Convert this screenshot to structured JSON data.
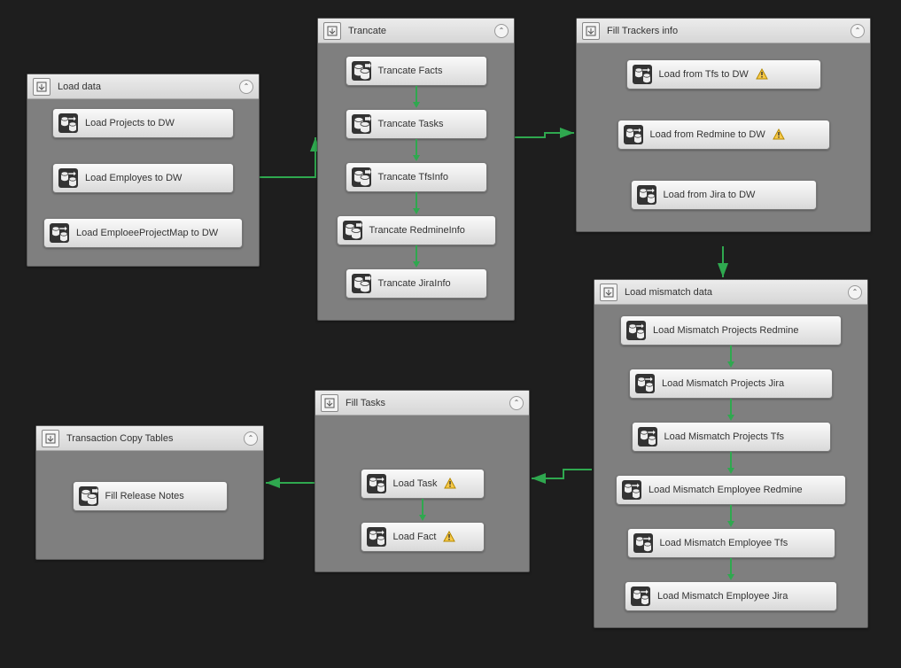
{
  "colors": {
    "connector": "#2fa84f",
    "canvas": "#1e1e1e",
    "container": "#7f7f7f"
  },
  "containers": {
    "loadData": {
      "title": "Load data",
      "tasks": [
        {
          "label": "Load Projects to DW",
          "icon": "dataflow",
          "warn": false
        },
        {
          "label": "Load Employes to DW",
          "icon": "dataflow",
          "warn": false
        },
        {
          "label": "Load EmploeeProjectMap to DW",
          "icon": "dataflow",
          "warn": false
        }
      ]
    },
    "truncate": {
      "title": "Trancate",
      "tasks": [
        {
          "label": "Trancate Facts",
          "icon": "sql",
          "warn": false
        },
        {
          "label": "Trancate Tasks",
          "icon": "sql",
          "warn": false
        },
        {
          "label": "Trancate TfsInfo",
          "icon": "sql",
          "warn": false
        },
        {
          "label": "Trancate RedmineInfo",
          "icon": "sql",
          "warn": false
        },
        {
          "label": "Trancate JiraInfo",
          "icon": "sql",
          "warn": false
        }
      ]
    },
    "fillTrackers": {
      "title": "Fill Trackers info",
      "tasks": [
        {
          "label": "Load from Tfs to DW",
          "icon": "dataflow",
          "warn": true
        },
        {
          "label": "Load from Redmine to DW",
          "icon": "dataflow",
          "warn": true
        },
        {
          "label": "Load from Jira to DW",
          "icon": "dataflow",
          "warn": false
        }
      ]
    },
    "loadMismatch": {
      "title": "Load mismatch data",
      "tasks": [
        {
          "label": "Load Mismatch Projects Redmine",
          "icon": "dataflow",
          "warn": false
        },
        {
          "label": "Load Mismatch Projects Jira",
          "icon": "dataflow",
          "warn": false
        },
        {
          "label": "Load Mismatch Projects Tfs",
          "icon": "dataflow",
          "warn": false
        },
        {
          "label": "Load Mismatch Employee Redmine",
          "icon": "dataflow",
          "warn": false
        },
        {
          "label": "Load Mismatch Employee Tfs",
          "icon": "dataflow",
          "warn": false
        },
        {
          "label": "Load Mismatch Employee Jira",
          "icon": "dataflow",
          "warn": false
        }
      ]
    },
    "fillTasks": {
      "title": "Fill Tasks",
      "tasks": [
        {
          "label": "Load Task",
          "icon": "dataflow",
          "warn": true
        },
        {
          "label": "Load Fact",
          "icon": "dataflow",
          "warn": true
        }
      ]
    },
    "transactionCopy": {
      "title": "Transaction Copy Tables",
      "tasks": [
        {
          "label": "Fill Release Notes",
          "icon": "sql",
          "warn": false
        }
      ]
    }
  }
}
